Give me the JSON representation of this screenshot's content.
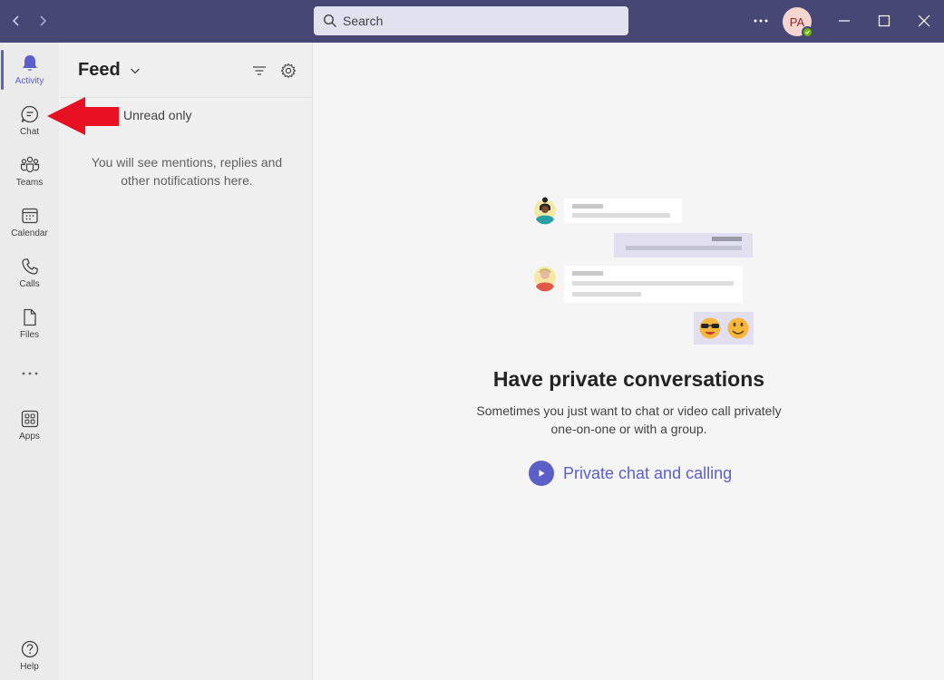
{
  "titlebar": {
    "search_placeholder": "Search",
    "avatar_initials": "PA",
    "colors": {
      "bar": "#464775",
      "search_bg": "#e1e1f0",
      "presence": "#6bb700"
    },
    "icons": [
      "back-arrow-icon",
      "forward-arrow-icon",
      "search-icon",
      "more-options-icon",
      "minimize-icon",
      "maximize-icon",
      "close-icon"
    ]
  },
  "rail": {
    "items": [
      {
        "label": "Activity",
        "icon": "bell-icon",
        "active": true
      },
      {
        "label": "Chat",
        "icon": "chat-bubble-icon"
      },
      {
        "label": "Teams",
        "icon": "teams-icon"
      },
      {
        "label": "Calendar",
        "icon": "calendar-icon"
      },
      {
        "label": "Calls",
        "icon": "phone-icon"
      },
      {
        "label": "Files",
        "icon": "file-icon"
      }
    ],
    "more_icon": "more-horizontal-icon",
    "apps": {
      "label": "Apps",
      "icon": "apps-grid-icon"
    },
    "help": {
      "label": "Help",
      "icon": "help-circle-icon"
    },
    "accent": "#5b5fc7"
  },
  "feed": {
    "title": "Feed",
    "unread_label": "Unread only",
    "empty_message": "You will see mentions, replies and other notifications here.",
    "icons": [
      "chevron-down-icon",
      "filter-icon",
      "settings-gear-icon"
    ]
  },
  "annotation": {
    "icon": "red-arrow-icon",
    "color": "#e81123"
  },
  "main": {
    "title": "Have private conversations",
    "description": "Sometimes you just want to chat or video call privately one-on-one or with a group.",
    "link_label": "Private chat and calling",
    "link_icon": "play-circle-icon",
    "accent": "#5b5fc7"
  }
}
